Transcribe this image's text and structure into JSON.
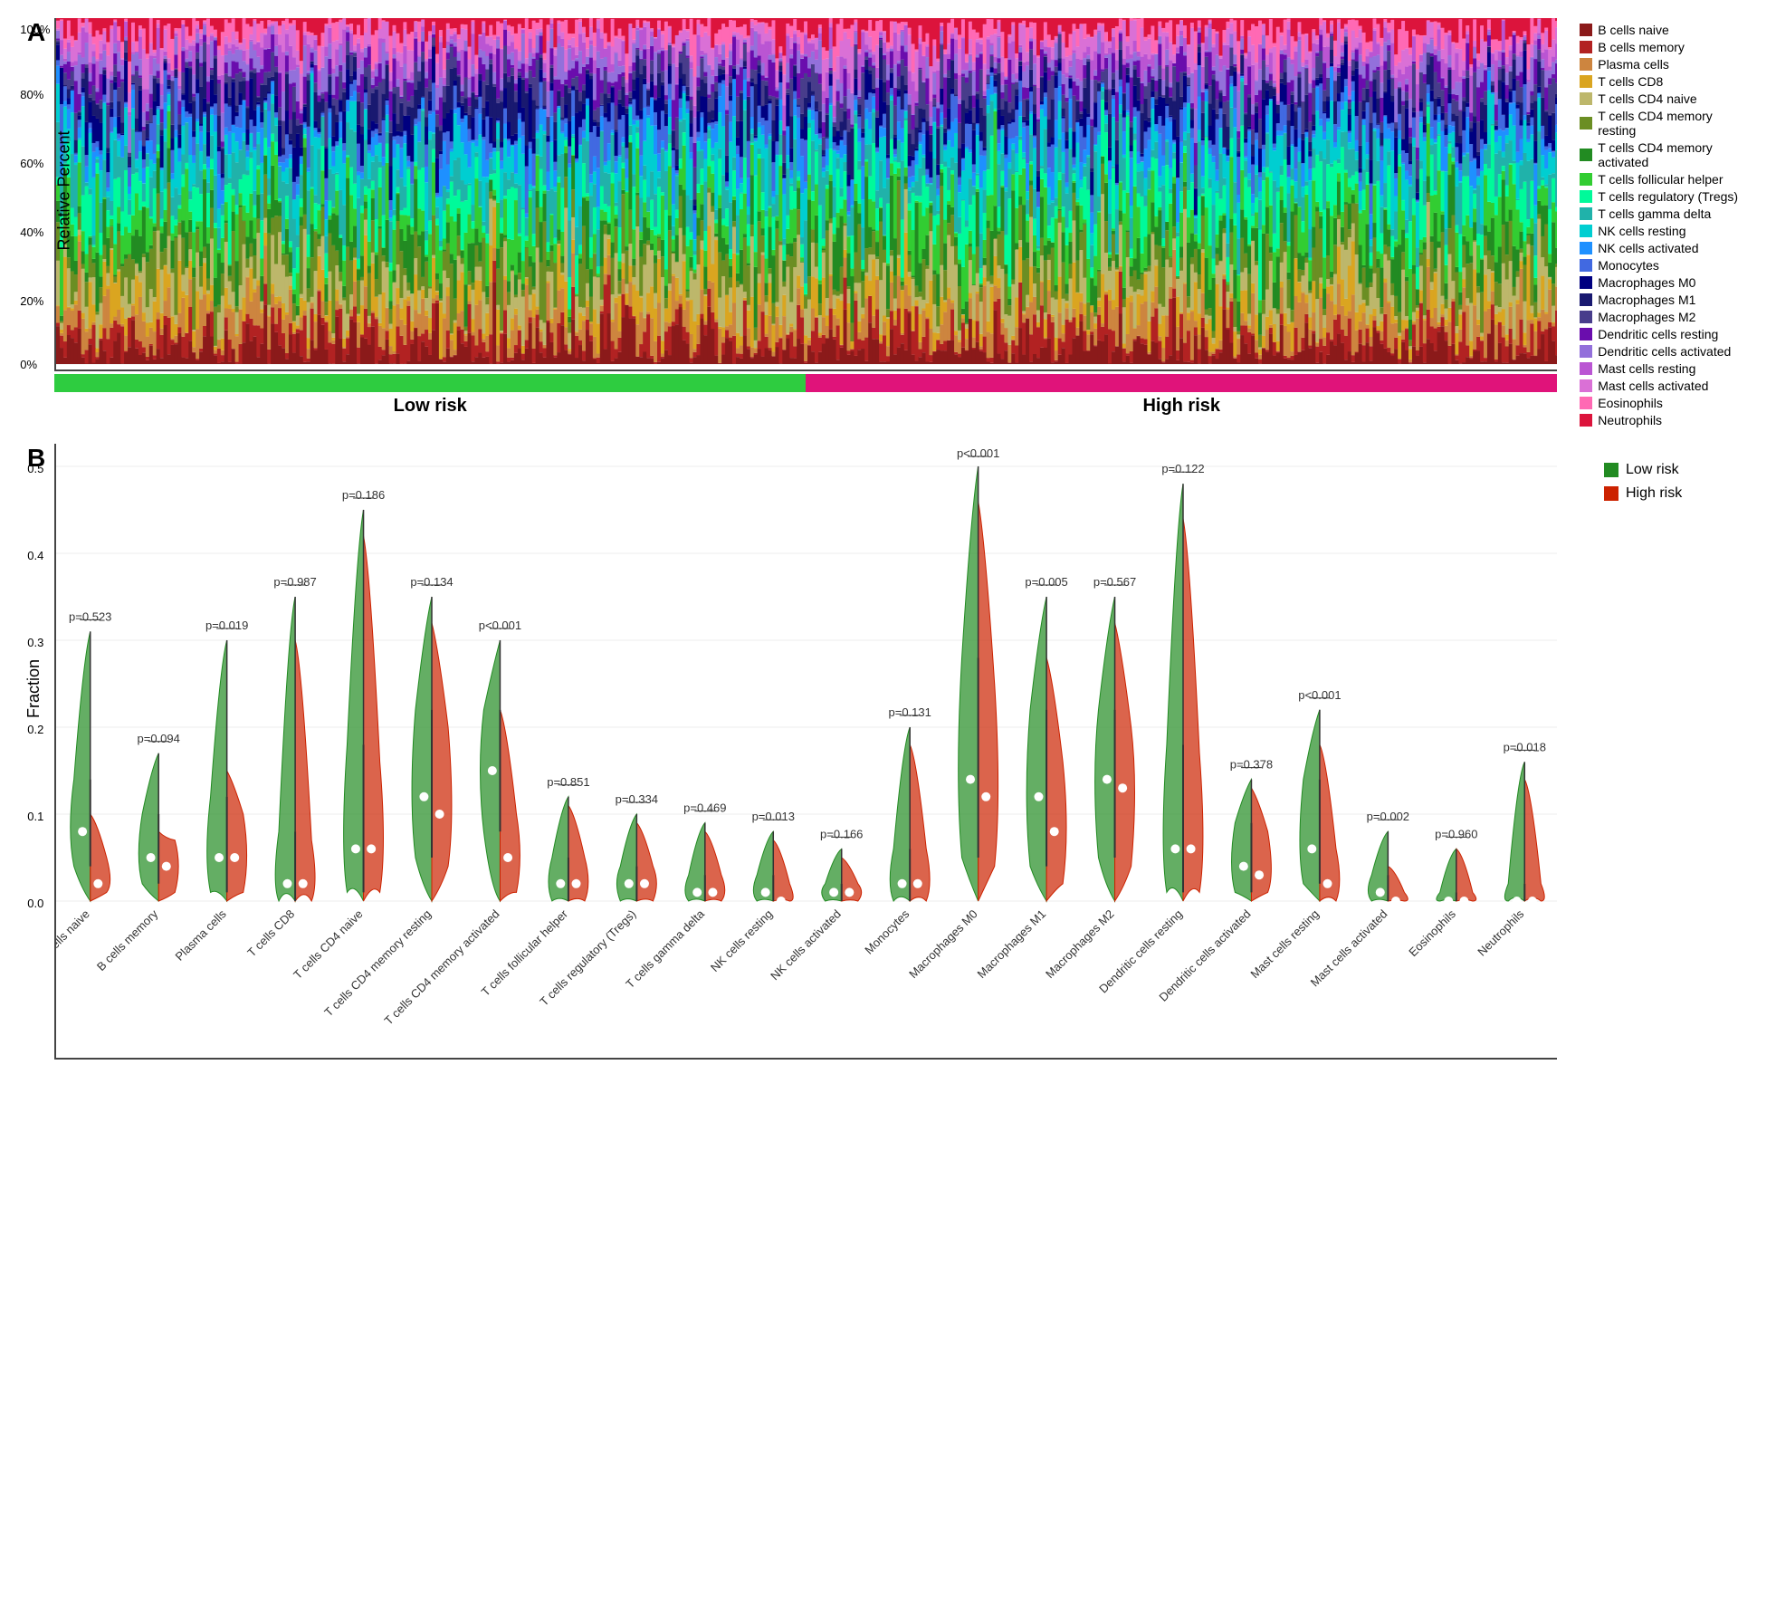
{
  "figure": {
    "panels": {
      "A": {
        "label": "A",
        "yAxisLabel": "Relative Percent",
        "yTicks": [
          "0%",
          "20%",
          "40%",
          "60%",
          "80%",
          "100%"
        ],
        "riskBar": {
          "low": {
            "label": "Low risk",
            "color": "#2ecc40"
          },
          "high": {
            "label": "High risk",
            "color": "#e0137a"
          }
        },
        "legend": [
          {
            "label": "B cells naive",
            "color": "#8B1A1A"
          },
          {
            "label": "B cells memory",
            "color": "#B22222"
          },
          {
            "label": "Plasma cells",
            "color": "#CD853F"
          },
          {
            "label": "T cells CD8",
            "color": "#DAA520"
          },
          {
            "label": "T cells CD4 naive",
            "color": "#BDB76B"
          },
          {
            "label": "T cells CD4 memory resting",
            "color": "#6B8E23"
          },
          {
            "label": "T cells CD4 memory activated",
            "color": "#228B22"
          },
          {
            "label": "T cells follicular helper",
            "color": "#32CD32"
          },
          {
            "label": "T cells regulatory (Tregs)",
            "color": "#00FA9A"
          },
          {
            "label": "T cells gamma delta",
            "color": "#20B2AA"
          },
          {
            "label": "NK cells resting",
            "color": "#00CED1"
          },
          {
            "label": "NK cells activated",
            "color": "#1E90FF"
          },
          {
            "label": "Monocytes",
            "color": "#4169E1"
          },
          {
            "label": "Macrophages M0",
            "color": "#000080"
          },
          {
            "label": "Macrophages M1",
            "color": "#191970"
          },
          {
            "label": "Macrophages M2",
            "color": "#483D8B"
          },
          {
            "label": "Dendritic cells resting",
            "color": "#6A0DAD"
          },
          {
            "label": "Dendritic cells activated",
            "color": "#9370DB"
          },
          {
            "label": "Mast cells resting",
            "color": "#BA55D3"
          },
          {
            "label": "Mast cells activated",
            "color": "#DA70D6"
          },
          {
            "label": "Eosinophils",
            "color": "#FF69B4"
          },
          {
            "label": "Neutrophils",
            "color": "#DC143C"
          }
        ]
      },
      "B": {
        "label": "B",
        "yAxisLabel": "Fraction",
        "yTicks": [
          "0.0",
          "0.1",
          "0.2",
          "0.3",
          "0.4",
          "0.5"
        ],
        "legend": [
          {
            "label": "Low risk",
            "color": "#228B22"
          },
          {
            "label": "High risk",
            "color": "#CC2200"
          }
        ],
        "violins": [
          {
            "name": "B cells naive",
            "pval": "p=0.523",
            "xLabel": "B cells naive"
          },
          {
            "name": "B cells memory",
            "pval": "p=0.094",
            "xLabel": "B cells memory"
          },
          {
            "name": "Plasma cells",
            "pval": "p=0.019",
            "xLabel": "Plasma cells"
          },
          {
            "name": "T cells CD8",
            "pval": "p=0.987",
            "xLabel": "T cells CD8"
          },
          {
            "name": "T cells CD4 naive",
            "pval": "p=0.186",
            "xLabel": "T cells CD4 naive"
          },
          {
            "name": "T cells CD4 memory resting",
            "pval": "p=0.134",
            "xLabel": "T cells CD4 memory resting"
          },
          {
            "name": "T cells CD4 memory activated",
            "pval": "p<0.001",
            "xLabel": "T cells CD4 memory activated"
          },
          {
            "name": "T cells follicular helper",
            "pval": "p=0.851",
            "xLabel": "T cells follicular helper"
          },
          {
            "name": "T cells regulatory (Tregs)",
            "pval": "p=0.334",
            "xLabel": "T cells regulatory (Tregs)"
          },
          {
            "name": "T cells gamma delta",
            "pval": "p=0.469",
            "xLabel": "T cells gamma delta"
          },
          {
            "name": "NK cells resting",
            "pval": "p=0.013",
            "xLabel": "NK cells resting"
          },
          {
            "name": "NK cells activated",
            "pval": "p=0.166",
            "xLabel": "NK cells activated"
          },
          {
            "name": "Monocytes",
            "pval": "p=0.131",
            "xLabel": "Monocytes"
          },
          {
            "name": "Macrophages M0",
            "pval": "p<0.001",
            "xLabel": "Macrophages M0"
          },
          {
            "name": "Macrophages M1",
            "pval": "p=0.005",
            "xLabel": "Macrophages M1"
          },
          {
            "name": "Macrophages M2",
            "pval": "p=0.567",
            "xLabel": "Macrophages M2"
          },
          {
            "name": "Dendritic cells resting",
            "pval": "p=0.122",
            "xLabel": "Dendritic cells resting"
          },
          {
            "name": "Dendritic cells activated",
            "pval": "p=0.378",
            "xLabel": "Dendritic cells activated"
          },
          {
            "name": "Mast cells resting",
            "pval": "p<0.001",
            "xLabel": "Mast cells resting"
          },
          {
            "name": "Mast cells activated",
            "pval": "p=0.002",
            "xLabel": "Mast cells activated"
          },
          {
            "name": "Eosinophils",
            "pval": "p=0.960",
            "xLabel": "Eosinophils"
          },
          {
            "name": "Neutrophils",
            "pval": "p=0.018",
            "xLabel": "Neutrophils"
          }
        ]
      }
    }
  }
}
